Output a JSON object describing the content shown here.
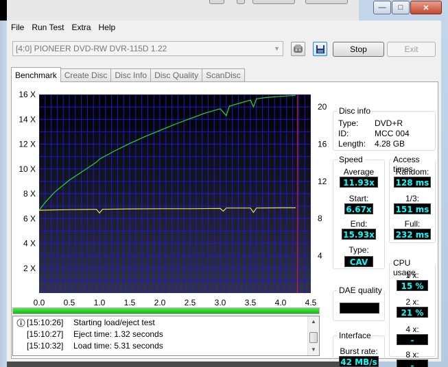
{
  "menu": [
    "File",
    "Run Test",
    "Extra",
    "Help"
  ],
  "window_buttons": [
    "minimize-icon",
    "maximize-icon",
    "close-icon"
  ],
  "drive": {
    "selected": "[4:0]  PIONEER DVD-RW  DVR-115D 1.22"
  },
  "toolbar": {
    "stop_label": "Stop",
    "exit_label": "Exit",
    "eject_icon": "eject-icon",
    "save_icon": "save-icon"
  },
  "tabs": [
    "Benchmark",
    "Create Disc",
    "Disc Info",
    "Disc Quality",
    "ScanDisc"
  ],
  "disc_info": {
    "title": "Disc info",
    "type_label": "Type:",
    "type_value": "DVD+R",
    "id_label": "ID:",
    "id_value": "MCC 004",
    "length_label": "Length:",
    "length_value": "4.28 GB"
  },
  "speed": {
    "title": "Speed",
    "average_label": "Average",
    "average_value": "11.93x",
    "start_label": "Start:",
    "start_value": "6.67x",
    "end_label": "End:",
    "end_value": "15.93x",
    "type_label": "Type:",
    "type_value": "CAV"
  },
  "access_times": {
    "title": "Access times",
    "random_label": "Random:",
    "random_value": "128 ms",
    "third_label": "1/3:",
    "third_value": "151 ms",
    "full_label": "Full:",
    "full_value": "232 ms"
  },
  "cpu_usage": {
    "title": "CPU usage",
    "x1_label": "1 x:",
    "x1_value": "15 %",
    "x2_label": "2 x:",
    "x2_value": "21 %",
    "x4_label": "4 x:",
    "x4_value": "-",
    "x8_label": "8 x:",
    "x8_value": "-"
  },
  "dae": {
    "title": "DAE quality",
    "value": ""
  },
  "interface": {
    "title": "Interface",
    "burst_label": "Burst rate:",
    "burst_value": "42 MB/s"
  },
  "progress": {
    "percent": 100
  },
  "log": [
    {
      "time": "[15:10:26]",
      "message": "Starting load/eject test",
      "icon": "info-icon"
    },
    {
      "time": "[15:10:27]",
      "message": "Eject time: 1.32 seconds"
    },
    {
      "time": "[15:10:32]",
      "message": "Load time: 5.31 seconds"
    }
  ],
  "colors": {
    "plot_bg_top": "#000000",
    "plot_bg_bottom": "#32324a",
    "grid": "#1a1ad8",
    "read_speed": "#22dd22",
    "rpm": "#e6e640",
    "marker": "#d02020",
    "lcd_text": "#00ffff"
  },
  "chart_data": {
    "type": "line",
    "x_ticks": [
      "0.0",
      "0.5",
      "1.0",
      "1.5",
      "2.0",
      "2.5",
      "3.0",
      "3.5",
      "4.0",
      "4.5"
    ],
    "y_left_ticks": [
      "2 X",
      "4 X",
      "6 X",
      "8 X",
      "10 X",
      "12 X",
      "14 X",
      "16 X"
    ],
    "y_right_ticks": [
      "4",
      "8",
      "12",
      "16",
      "20"
    ],
    "xlim": [
      0,
      4.5
    ],
    "ylim_left": [
      0,
      16
    ],
    "ylim_right": [
      0,
      21.33
    ],
    "end_marker_x": 4.28,
    "grid": true,
    "series": [
      {
        "axis": "left",
        "x": [
          0,
          0.1,
          0.25,
          0.5,
          0.75,
          0.95,
          1.0,
          1.25,
          1.5,
          1.75,
          2.0,
          2.25,
          2.5,
          2.75,
          3.0,
          3.1,
          3.15,
          3.25,
          3.5,
          3.55,
          3.6,
          3.75,
          4.0,
          4.25
        ],
        "y": [
          6.67,
          7.3,
          8.1,
          9.1,
          9.9,
          10.55,
          10.8,
          11.45,
          12.05,
          12.6,
          13.1,
          13.6,
          14.05,
          14.5,
          14.85,
          14.3,
          15.05,
          15.2,
          15.55,
          15.0,
          15.65,
          15.75,
          15.85,
          15.93
        ]
      },
      {
        "axis": "left",
        "x": [
          0,
          0.2,
          0.5,
          0.95,
          1.0,
          1.05,
          1.5,
          2.0,
          2.5,
          3.0,
          3.05,
          3.1,
          3.5,
          3.55,
          3.6,
          4.0,
          4.25
        ],
        "y": [
          6.67,
          6.7,
          6.72,
          6.75,
          6.45,
          6.75,
          6.78,
          6.8,
          6.8,
          6.82,
          6.6,
          6.85,
          6.85,
          6.5,
          6.85,
          6.87,
          6.87
        ]
      }
    ]
  }
}
